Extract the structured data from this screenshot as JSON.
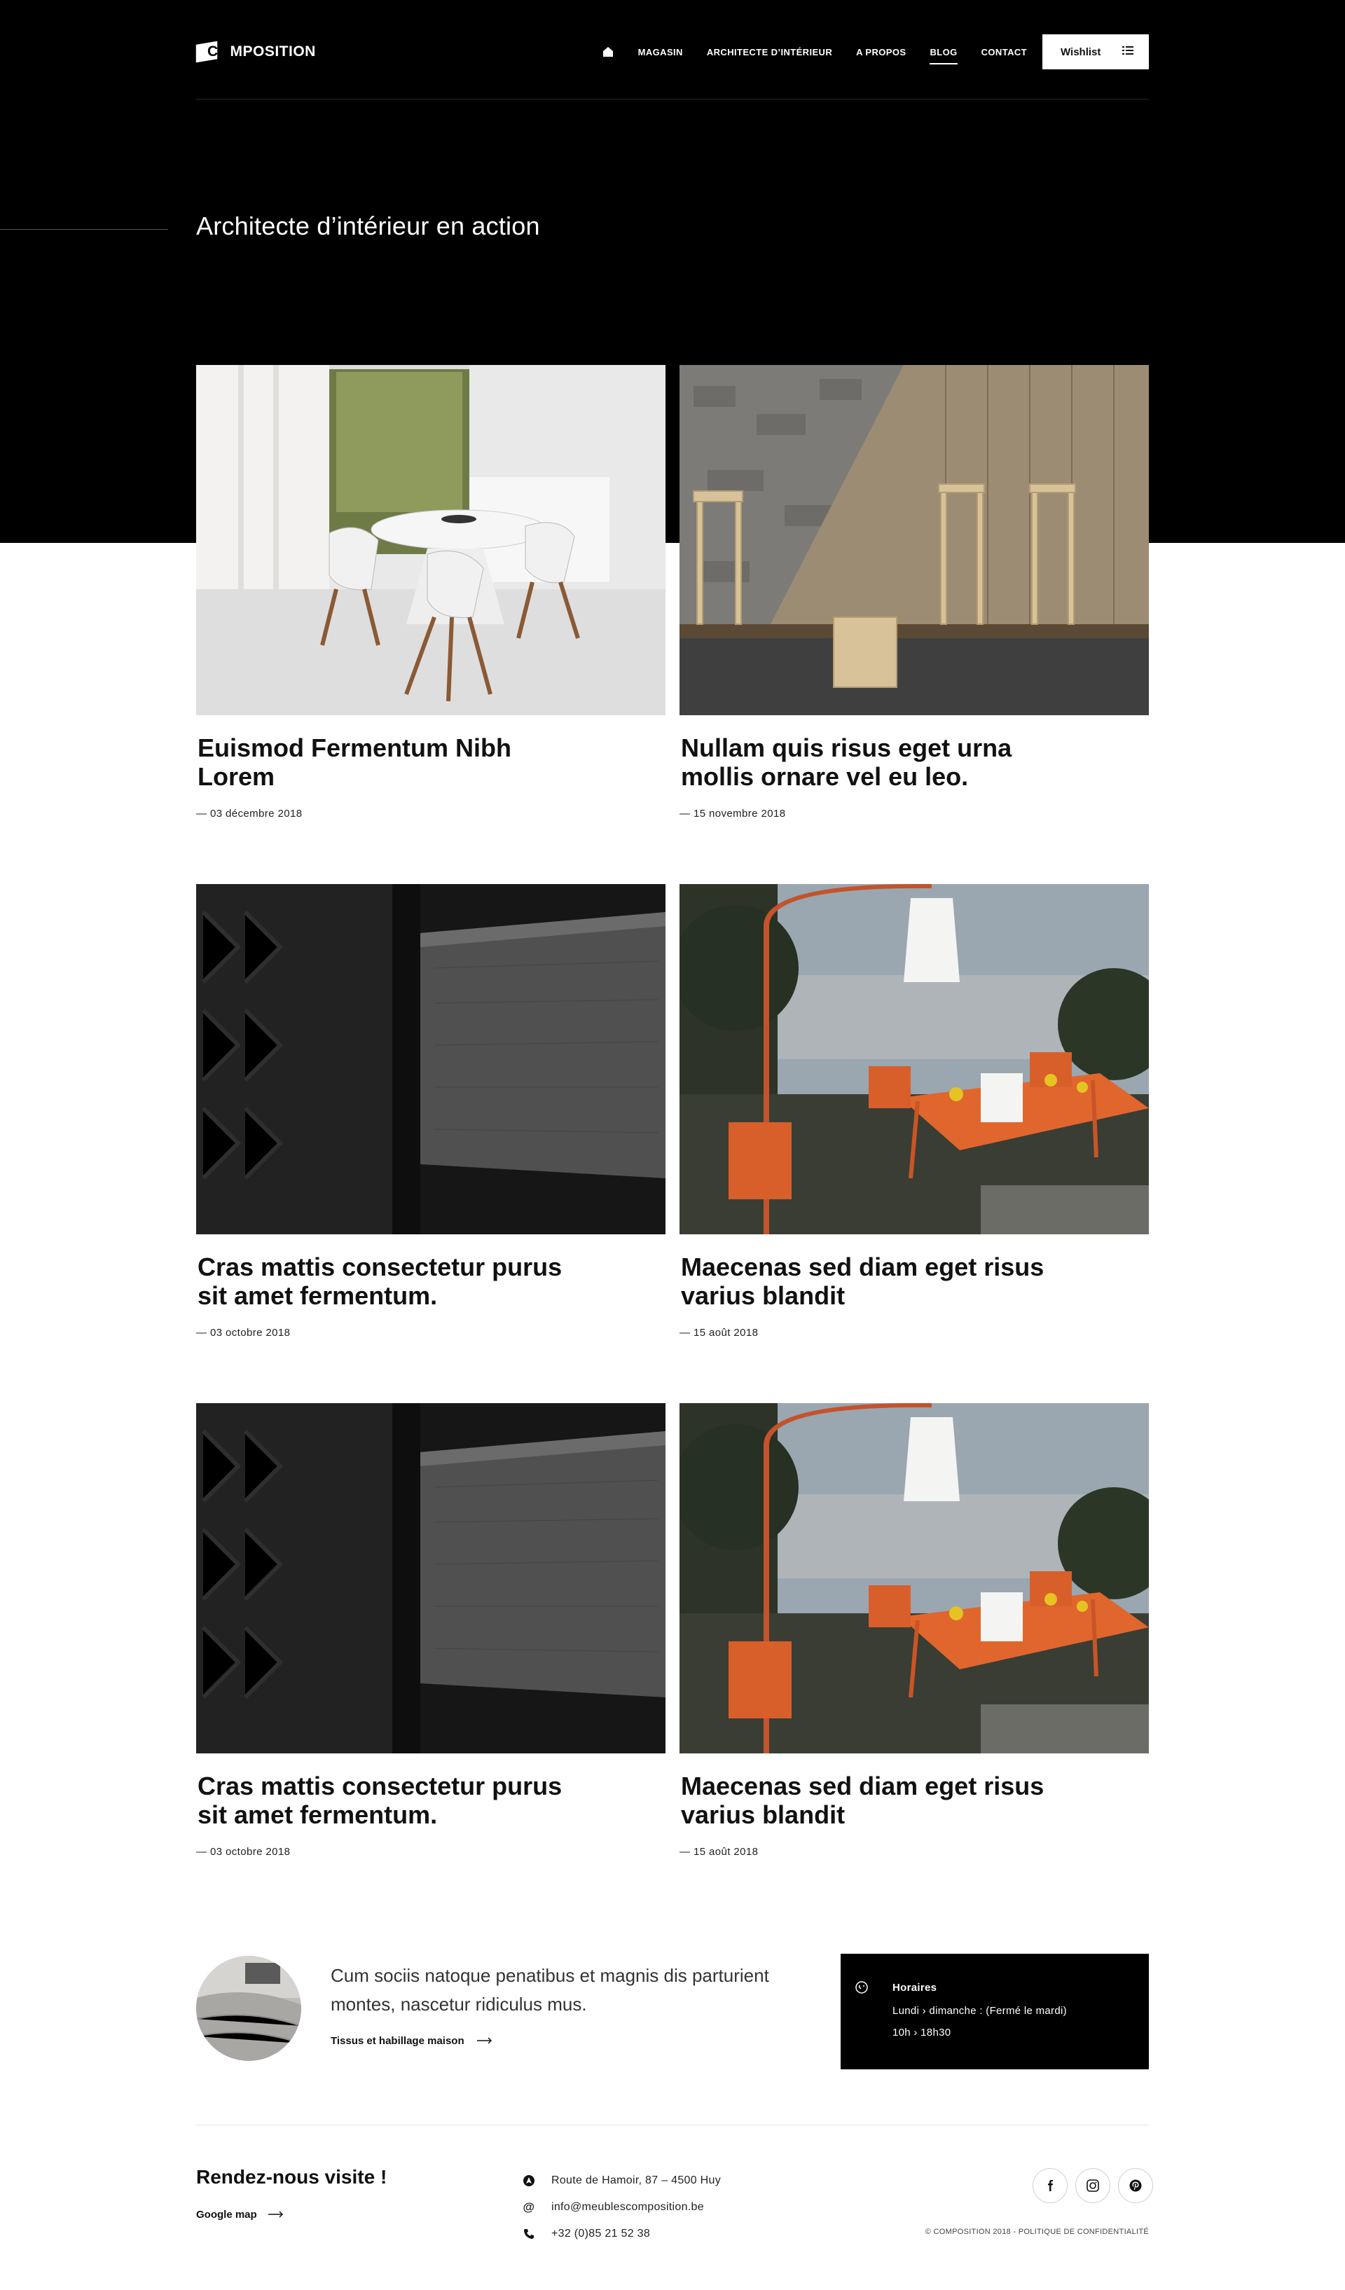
{
  "header": {
    "logo_co": "CO",
    "logo_rest": "MPOSITION",
    "nav": [
      {
        "label": "MAGASIN"
      },
      {
        "label": "ARCHITECTE D’INTÉRIEUR"
      },
      {
        "label": "A PROPOS"
      },
      {
        "label": "BLOG",
        "active": true
      },
      {
        "label": "CONTACT"
      }
    ],
    "wishlist_label": "Wishlist"
  },
  "page_title": "Architecte d’intérieur en action",
  "articles": [
    {
      "title": "Euismod Fermentum Nibh Lorem",
      "date": "— 03 décembre 2018",
      "image": "dining-room-white-table"
    },
    {
      "title": "Nullam quis risus eget urna mollis ornare vel eu leo.",
      "date": "— 15 novembre 2018",
      "image": "wooden-chairs-stone-wall"
    },
    {
      "title": "Cras mattis consectetur purus sit amet fermentum.",
      "date": "— 03 octobre 2018",
      "image": "dark-wood-drawer"
    },
    {
      "title": "Maecenas sed diam eget risus varius blandit",
      "date": "— 15 août 2018",
      "image": "orange-terrace-lamps"
    },
    {
      "title": "Cras mattis consectetur purus sit amet fermentum.",
      "date": "— 03 octobre 2018",
      "image": "dark-wood-drawer"
    },
    {
      "title": "Maecenas sed diam eget risus varius blandit",
      "date": "— 15 août 2018",
      "image": "orange-terrace-lamps"
    }
  ],
  "promo": {
    "text": "Cum sociis natoque penatibus et magnis dis parturient montes, nascetur ridiculus mus.",
    "link_label": "Tissus et habillage maison"
  },
  "hours": {
    "title": "Horaires",
    "line1": "Lundi › dimanche :  (Fermé le mardi)",
    "line2": "10h › 18h30"
  },
  "footer": {
    "visit_title": "Rendez-nous visite !",
    "gmap_label": "Google map",
    "address": "Route de Hamoir, 87 – 4500 Huy",
    "email": "info@meublescomposition.be",
    "phone": "+32 (0)85 21 52 38",
    "copyright": "© COMPOSITION 2018 - POLITIQUE DE CONFIDENTIALITÉ"
  },
  "colors": {
    "dark": "#000000",
    "accent_orange": "#d4572a",
    "text": "#111111"
  }
}
